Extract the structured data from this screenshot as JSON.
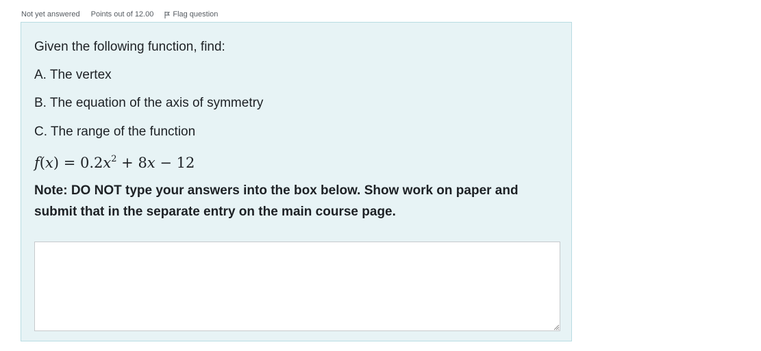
{
  "question": {
    "info": {
      "state": "Not yet answered",
      "grade": "Points out of 12.00",
      "flag_label": "Flag question"
    },
    "text": {
      "intro": "Given the following function, find:",
      "part_a": "A.  The vertex",
      "part_b": "B. The equation of the axis of symmetry",
      "part_c": "C. The range of the function",
      "note": "Note: DO NOT type your answers into the box below. Show work on paper and submit that in the separate entry on the main course page."
    },
    "function_math": {
      "f": "f",
      "open_paren": "(",
      "var": "x",
      "close_eq": ") = 0.2",
      "x2": "x",
      "exp": "2",
      "plus": " + 8",
      "x1": "x",
      "minus": " − 12"
    },
    "answer": {
      "value": ""
    }
  },
  "colors": {
    "formulation_bg": "#e7f3f5",
    "formulation_border": "#b8dce2",
    "text": "#1d2125",
    "muted_text": "#555b61"
  },
  "icons": {
    "flag": "flag-icon",
    "resize": "resize-handle-icon"
  }
}
